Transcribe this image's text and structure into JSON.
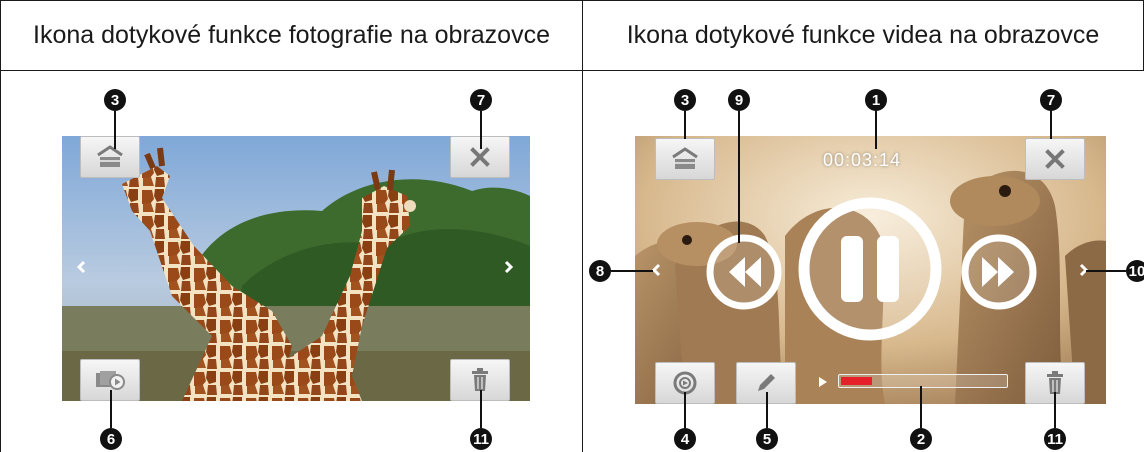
{
  "headers": {
    "photo": "Ikona dotykové funkce fotografie na obrazovce",
    "video": "Ikona dotykové funkce videa na obrazovce"
  },
  "photo_panel": {
    "badges": {
      "exit_mode": "3",
      "close": "7",
      "slideshow": "6",
      "delete": "11"
    },
    "icons": {
      "exit_mode": "home-box-icon",
      "close": "close-x-icon",
      "prev": "chevron-left-icon",
      "next": "chevron-right-icon",
      "slideshow": "slideshow-play-icon",
      "delete": "trash-icon"
    }
  },
  "video_panel": {
    "time": "00:03:14",
    "progress_fraction": 0.19,
    "badges": {
      "time": "1",
      "progress": "2",
      "exit_mode": "3",
      "rotate": "4",
      "edit": "5",
      "close": "7",
      "prev": "8",
      "rewind": "9",
      "next": "10",
      "delete": "11"
    },
    "icons": {
      "exit_mode": "home-box-icon",
      "close": "close-x-icon",
      "rewind": "rewind-icon",
      "pause": "pause-icon",
      "forward": "fast-forward-icon",
      "rotate": "rotate-icon",
      "edit": "pencil-icon",
      "delete": "trash-icon",
      "play_indicator": "play-triangle-icon"
    }
  },
  "colors": {
    "progress_fill": "#e5202a",
    "badge": "#111111",
    "button_bg": "#e6e6e6"
  }
}
